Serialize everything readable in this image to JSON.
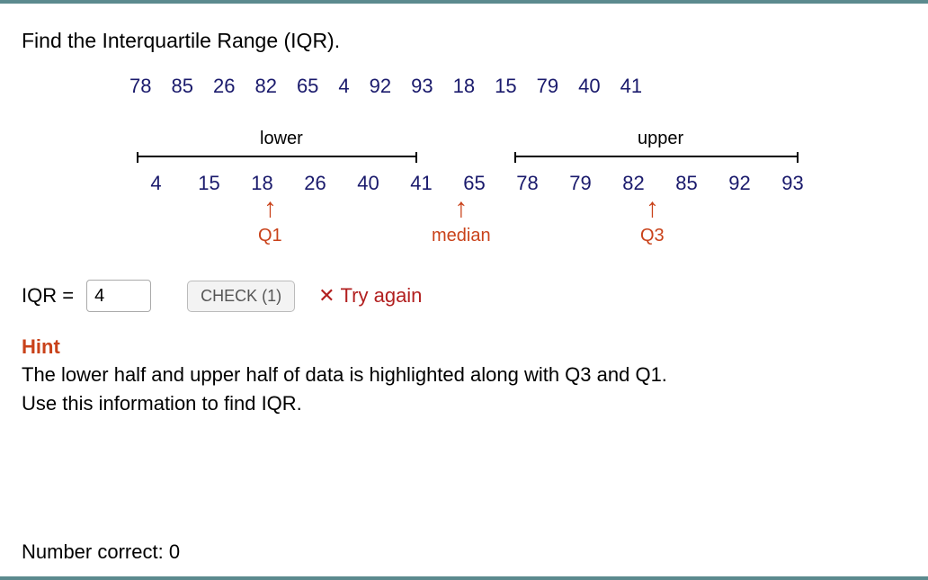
{
  "prompt": "Find the Interquartile Range (IQR).",
  "unsorted": [
    "78",
    "85",
    "26",
    "82",
    "65",
    "4",
    "92",
    "93",
    "18",
    "15",
    "79",
    "40",
    "41"
  ],
  "half_labels": {
    "lower": "lower",
    "upper": "upper"
  },
  "sorted": [
    "4",
    "15",
    "18",
    "26",
    "40",
    "41",
    "65",
    "78",
    "79",
    "82",
    "85",
    "92",
    "93"
  ],
  "markers": {
    "q1": "Q1",
    "median": "median",
    "q3": "Q3"
  },
  "answer": {
    "label": "IQR =",
    "value": "4",
    "check_label": "CHECK (1)",
    "feedback": "Try again"
  },
  "hint": {
    "title": "Hint",
    "line1": "The lower half and upper half of data is highlighted along with Q3 and Q1.",
    "line2": "Use this information to find IQR."
  },
  "footer": "Number correct: 0"
}
